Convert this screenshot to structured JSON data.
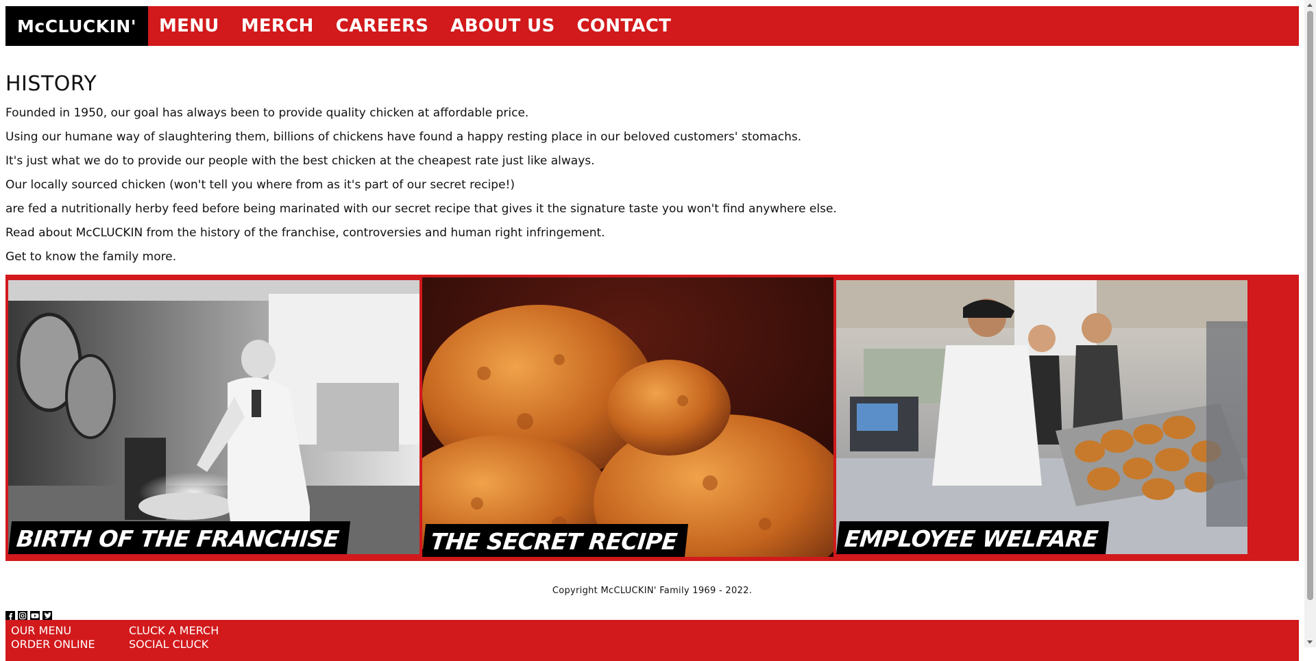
{
  "nav": {
    "brand": "McCLUCKIN'",
    "items": [
      "MENU",
      "MERCH",
      "CAREERS",
      "ABOUT US",
      "CONTACT"
    ]
  },
  "main": {
    "title": "HISTORY",
    "paragraphs": [
      "Founded in 1950, our goal has always been to provide quality chicken at affordable price.",
      "Using our humane way of slaughtering them, billions of chickens have found a happy resting place in our beloved customers' stomachs.",
      "It's just what we do to provide our people with the best chicken at the cheapest rate just like always.",
      "Our locally sourced chicken (won't tell you where from as it's part of our secret recipe!)",
      "are fed a nutritionally herby feed before being marinated with our secret recipe that gives it the signature taste you won't find anywhere else.",
      "Read about McCLUCKIN from the history of the franchise, controversies and human right infringement.",
      "Get to know the family more."
    ]
  },
  "gallery": {
    "cards": [
      {
        "caption": "BIRTH OF THE FRANCHISE"
      },
      {
        "caption": "THE SECRET RECIPE"
      },
      {
        "caption": "EMPLOYEE WELFARE"
      }
    ]
  },
  "footer": {
    "copyright": "Copyright McCLUCKIN' Family 1969 - 2022.",
    "social_icons": [
      "facebook-icon",
      "instagram-icon",
      "youtube-icon",
      "twitter-icon"
    ],
    "col1": [
      "OUR MENU",
      "ORDER ONLINE"
    ],
    "col2": [
      "CLUCK A MERCH",
      "SOCIAL CLUCK"
    ]
  },
  "colors": {
    "brand_red": "#d2191b",
    "brand_black": "#000000"
  }
}
